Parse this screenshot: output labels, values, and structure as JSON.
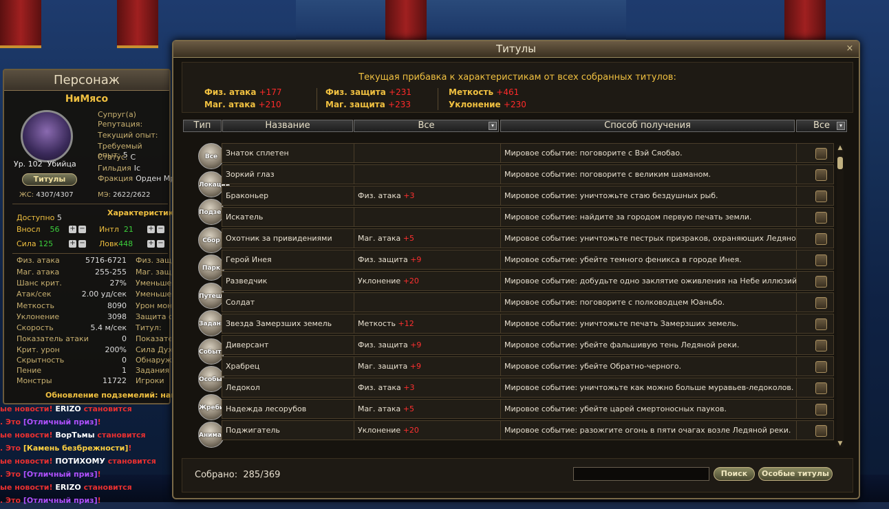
{
  "character": {
    "panel_title": "Персонаж",
    "name": "НиМясо",
    "level": "Ур. 102",
    "class": "Убийца",
    "titles_button": "Титулы",
    "info": [
      {
        "label": "Супруг(а)",
        "value": ""
      },
      {
        "label": "Репутация:",
        "value": ""
      },
      {
        "label": "Текущий опыт:",
        "value": ""
      },
      {
        "label": "Требуемый опыт:",
        "value": "5"
      },
      {
        "label": "Статус:",
        "value": "С"
      },
      {
        "label": "Гильдия",
        "value": "Ic"
      },
      {
        "label": "Фракция",
        "value": "Орден Мр"
      }
    ],
    "hp_label": "ЖС:",
    "hp": "4307/4307",
    "mp_label": "МЭ:",
    "mp": "2622/2622",
    "available_label": "Доступно",
    "available": "5",
    "chars_title": "Характеристики",
    "vit_label": "Вносл",
    "vit": "56",
    "int_label": "Интл",
    "int": "21",
    "str_label": "Сила",
    "str": "125",
    "dex_label": "Ловк",
    "dex": "448",
    "plus": "+",
    "minus": "−",
    "stats": [
      {
        "label": "Физ. атака",
        "value": "5716-6721"
      },
      {
        "label": "Маг. атака",
        "value": "255-255"
      },
      {
        "label": "Шанс крит.",
        "value": "27%"
      },
      {
        "label": "Атак/сек",
        "value": "2.00 уд/сек"
      },
      {
        "label": "Меткость",
        "value": "8090"
      },
      {
        "label": "Уклонение",
        "value": "3098"
      },
      {
        "label": "Скорость",
        "value": "5.4 м/сек"
      },
      {
        "label": "Показатель атаки",
        "value": "0"
      },
      {
        "label": "Крит. урон",
        "value": "200%"
      },
      {
        "label": "Скрытность",
        "value": "0"
      },
      {
        "label": "Пение",
        "value": "1"
      },
      {
        "label": "Монстры",
        "value": "11722"
      }
    ],
    "stats_right": [
      "Физ. защ",
      "Маг. защ",
      "Уменьше",
      "Уменьше",
      "Урон мон",
      "Защита о",
      "Титул:",
      "Показате",
      "Сила Дух",
      "Обнаруж",
      "Задания",
      "Игроки"
    ],
    "dungeon_update": "Обновление подземелий: написа"
  },
  "chat": [
    [
      {
        "t": "ые новости! ",
        "c": "c-r"
      },
      {
        "t": "ERIZO",
        "c": "c-w"
      },
      {
        "t": " становится",
        "c": "c-r"
      }
    ],
    [
      {
        "t": ". Это ",
        "c": "c-r"
      },
      {
        "t": "[Отличный приз]",
        "c": "c-p"
      },
      {
        "t": "!",
        "c": "c-r"
      }
    ],
    [
      {
        "t": "ые новости! ",
        "c": "c-r"
      },
      {
        "t": "ВорТьмы",
        "c": "c-w"
      },
      {
        "t": " становится",
        "c": "c-r"
      }
    ],
    [
      {
        "t": ". Это ",
        "c": "c-r"
      },
      {
        "t": "[Камень безбрежности]",
        "c": "c-y"
      },
      {
        "t": "!",
        "c": "c-r"
      }
    ],
    [
      {
        "t": "ые новости! ",
        "c": "c-r"
      },
      {
        "t": "ПОТИХОМУ",
        "c": "c-w"
      },
      {
        "t": " становится",
        "c": "c-r"
      }
    ],
    [
      {
        "t": ". Это ",
        "c": "c-r"
      },
      {
        "t": "[Отличный приз]",
        "c": "c-p"
      },
      {
        "t": "!",
        "c": "c-r"
      }
    ],
    [
      {
        "t": "ые новости! ",
        "c": "c-r"
      },
      {
        "t": "ERIZO",
        "c": "c-w"
      },
      {
        "t": " становится",
        "c": "c-r"
      }
    ],
    [
      {
        "t": ". Это ",
        "c": "c-r"
      },
      {
        "t": "[Отличный приз]",
        "c": "c-p"
      },
      {
        "t": "!",
        "c": "c-r"
      }
    ]
  ],
  "window": {
    "title": "Титулы",
    "close": "×",
    "bonus_title": "Текущая прибавка к характеристикам от всех собранных титулов:",
    "bonuses": [
      {
        "label": "Физ. атака",
        "value": "+177"
      },
      {
        "label": "Маг. атака",
        "value": "+210"
      },
      {
        "label": "Физ. защита",
        "value": "+231"
      },
      {
        "label": "Маг. защита",
        "value": "+233"
      },
      {
        "label": "Меткость",
        "value": "+461"
      },
      {
        "label": "Уклонение",
        "value": "+230"
      }
    ],
    "headers": {
      "type": "Тип",
      "name": "Название",
      "filter": "Все",
      "method": "Способ получения",
      "filter2": "Все",
      "arrow": "▾"
    },
    "categories": [
      "Все",
      "Локации",
      "Подзем.",
      "Сбор",
      "Парк",
      "Путеш.",
      "Задания",
      "События",
      "Особые",
      "Жребий",
      "Анимация"
    ],
    "rows": [
      {
        "name": "Знаток сплетен",
        "stat": "",
        "val": "",
        "method": "Мировое событие: поговорите с Вэй Сяобао."
      },
      {
        "name": "Зоркий глаз",
        "stat": "",
        "val": "",
        "method": "Мировое событие: поговорите с великим шаманом."
      },
      {
        "name": "Браконьер",
        "stat": "Физ. атака",
        "val": "+3",
        "method": "Мировое событие: уничтожьте стаю бездушных рыб."
      },
      {
        "name": "Искатель",
        "stat": "",
        "val": "",
        "method": "Мировое событие: найдите за городом первую печать земли."
      },
      {
        "name": "Охотник за привидениями",
        "stat": "Маг. атака",
        "val": "+5",
        "method": "Мировое событие: уничтожьте пестрых призраков, охраняющих Ледяной"
      },
      {
        "name": "Герой Инея",
        "stat": "Физ. защита",
        "val": "+9",
        "method": "Мировое событие: убейте темного феникса в городе Инея."
      },
      {
        "name": "Разведчик",
        "stat": "Уклонение",
        "val": "+20",
        "method": "Мировое событие: добудьте одно заклятие оживления на Небе иллюзий."
      },
      {
        "name": "Солдат",
        "stat": "",
        "val": "",
        "method": "Мировое событие: поговорите с полководцем Юаньбо."
      },
      {
        "name": "Звезда Замерзших земель",
        "stat": "Меткость",
        "val": "+12",
        "method": "Мировое событие: уничтожьте печать Замерзших земель."
      },
      {
        "name": "Диверсант",
        "stat": "Физ. защита",
        "val": "+9",
        "method": "Мировое событие: убейте фальшивую тень Ледяной реки."
      },
      {
        "name": "Храбрец",
        "stat": "Маг. защита",
        "val": "+9",
        "method": "Мировое событие: убейте Обратно-черного."
      },
      {
        "name": "Ледокол",
        "stat": "Физ. атака",
        "val": "+3",
        "method": "Мировое событие: уничтожьте как можно больше муравьев-ледоколов."
      },
      {
        "name": "Надежда лесорубов",
        "stat": "Маг. атака",
        "val": "+5",
        "method": "Мировое событие: убейте царей смертоносных пауков."
      },
      {
        "name": "Поджигатель",
        "stat": "Уклонение",
        "val": "+20",
        "method": "Мировое событие: разожгите огонь в пяти очагах возле Ледяной реки."
      }
    ],
    "collected_label": "Собрано:",
    "collected": "285/369",
    "search_placeholder": "",
    "search_button": "Поиск",
    "special_button": "Особые титулы"
  }
}
